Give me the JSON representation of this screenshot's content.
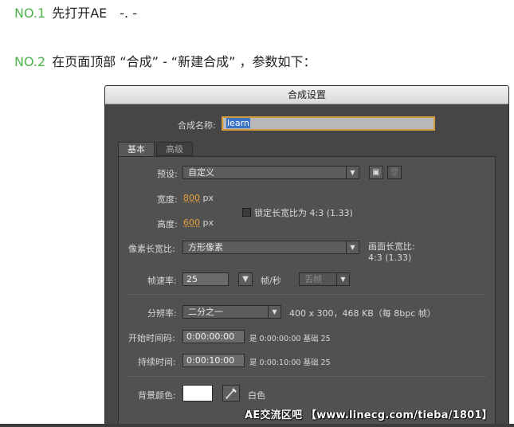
{
  "steps": [
    {
      "num": "NO.1",
      "text": "先打开AE　-. -"
    },
    {
      "num": "NO.2",
      "text": "在页面顶部 “合成” - “新建合成” ，参数如下："
    }
  ],
  "dialog": {
    "title": "合成设置",
    "name_label": "合成名称:",
    "name_value": "learn",
    "tabs": [
      "基本",
      "高级"
    ],
    "preset_label": "预设:",
    "preset_value": "自定义",
    "width_label": "宽度:",
    "width_value": "800",
    "width_unit": "px",
    "height_label": "高度:",
    "height_value": "600",
    "height_unit": "px",
    "lock_label": "锁定长宽比为 4:3 (1.33)",
    "pixel_aspect_label": "像素长宽比:",
    "pixel_aspect_value": "方形像素",
    "frame_aspect_label": "画面长宽比:",
    "frame_aspect_value": "4:3 (1.33)",
    "fps_label": "帧速率:",
    "fps_value": "25",
    "fps_unit": "帧/秒",
    "drop_frame": "丢帧",
    "resolution_label": "分辨率:",
    "resolution_value": "二分之一",
    "resolution_info": "400 x 300，468 KB（每 8bpc 帧）",
    "start_label": "开始时间码:",
    "start_value": "0:00:00:00",
    "start_info": "是 0:00:00:00  基础 25",
    "duration_label": "持续时间:",
    "duration_value": "0:00:10:00",
    "duration_info": "是 0:00:10:00  基础 25",
    "bg_label": "背景颜色:",
    "bg_color_name": "白色",
    "bg_color": "#ffffff"
  },
  "watermark": "AE交流区吧 【www.linecg.com/tieba/1801】",
  "colors": {
    "accent_green": "#4bb34b",
    "accent_orange": "#e8a23a"
  }
}
